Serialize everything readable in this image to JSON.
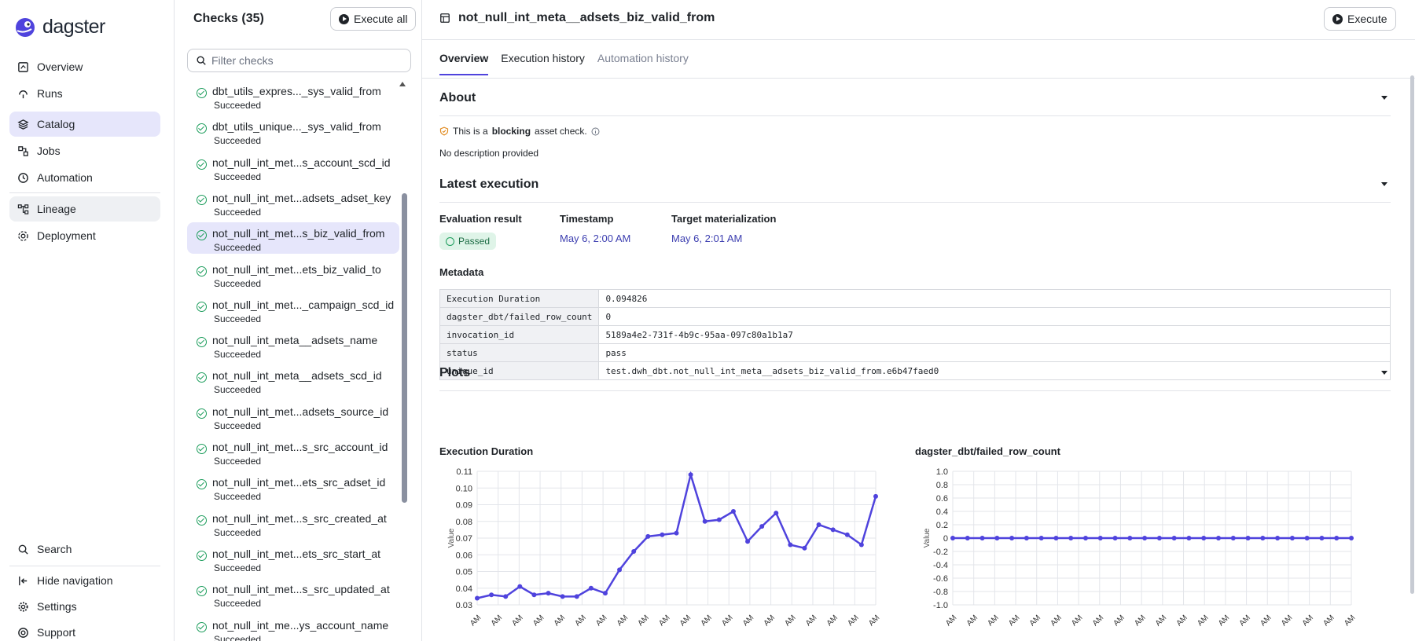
{
  "app": {
    "brand": "dagster",
    "accent": "#4f43dd"
  },
  "nav": {
    "items": [
      {
        "label": "Overview",
        "icon": "overview-icon"
      },
      {
        "label": "Runs",
        "icon": "runs-icon"
      },
      {
        "label": "Catalog",
        "icon": "catalog-icon"
      },
      {
        "label": "Jobs",
        "icon": "jobs-icon"
      },
      {
        "label": "Automation",
        "icon": "clock-icon"
      }
    ],
    "items2": [
      {
        "label": "Lineage",
        "icon": "lineage-icon"
      },
      {
        "label": "Deployment",
        "icon": "deployment-icon"
      }
    ],
    "bottom": [
      {
        "label": "Search",
        "icon": "search-icon"
      },
      {
        "label": "Hide navigation",
        "icon": "hide-nav-icon"
      },
      {
        "label": "Settings",
        "icon": "gear-icon"
      },
      {
        "label": "Support",
        "icon": "support-icon"
      }
    ]
  },
  "checks": {
    "title": "Checks (35)",
    "execute_all": "Execute all",
    "filter_placeholder": "Filter checks",
    "items": [
      {
        "name": "dbt_utils_expres..._sys_valid_from",
        "status": "Succeeded"
      },
      {
        "name": "dbt_utils_unique..._sys_valid_from",
        "status": "Succeeded"
      },
      {
        "name": "not_null_int_met...s_account_scd_id",
        "status": "Succeeded"
      },
      {
        "name": "not_null_int_met...adsets_adset_key",
        "status": "Succeeded"
      },
      {
        "name": "not_null_int_met...s_biz_valid_from",
        "status": "Succeeded"
      },
      {
        "name": "not_null_int_met...ets_biz_valid_to",
        "status": "Succeeded"
      },
      {
        "name": "not_null_int_met..._campaign_scd_id",
        "status": "Succeeded"
      },
      {
        "name": "not_null_int_meta__adsets_name",
        "status": "Succeeded"
      },
      {
        "name": "not_null_int_meta__adsets_scd_id",
        "status": "Succeeded"
      },
      {
        "name": "not_null_int_met...adsets_source_id",
        "status": "Succeeded"
      },
      {
        "name": "not_null_int_met...s_src_account_id",
        "status": "Succeeded"
      },
      {
        "name": "not_null_int_met...ets_src_adset_id",
        "status": "Succeeded"
      },
      {
        "name": "not_null_int_met...s_src_created_at",
        "status": "Succeeded"
      },
      {
        "name": "not_null_int_met...ets_src_start_at",
        "status": "Succeeded"
      },
      {
        "name": "not_null_int_met...s_src_updated_at",
        "status": "Succeeded"
      },
      {
        "name": "not_null_int_me...ys_account_name",
        "status": "Succeeded"
      }
    ]
  },
  "main": {
    "title": "not_null_int_meta__adsets_biz_valid_from",
    "execute": "Execute",
    "tabs": [
      "Overview",
      "Execution history",
      "Automation history"
    ],
    "about": {
      "title": "About",
      "blocking_pre": "This is a",
      "blocking_bold": "blocking",
      "blocking_post": "asset check.",
      "description": "No description provided"
    },
    "latest": {
      "title": "Latest execution",
      "eval_label": "Evaluation result",
      "eval_value": "Passed",
      "ts_label": "Timestamp",
      "ts_value": "May 6, 2:00 AM",
      "target_label": "Target materialization",
      "target_value": "May 6, 2:01 AM"
    },
    "metadata": {
      "title": "Metadata",
      "rows": [
        {
          "key": "Execution Duration",
          "value": "0.094826"
        },
        {
          "key": "dagster_dbt/failed_row_count",
          "value": "0"
        },
        {
          "key": "invocation_id",
          "value": "5189a4e2-731f-4b9c-95aa-097c80a1b1a7"
        },
        {
          "key": "status",
          "value": "pass"
        },
        {
          "key": "unique_id",
          "value": "test.dwh_dbt.not_null_int_meta__adsets_biz_valid_from.e6b47faed0"
        }
      ]
    },
    "plots_title": "Plots"
  },
  "chart_data": [
    {
      "type": "line",
      "title": "Execution Duration",
      "ylabel": "Value",
      "ylim": [
        0.03,
        0.11
      ],
      "yticks": [
        "0.11",
        "0.10",
        "0.09",
        "0.08",
        "0.07",
        "0.06",
        "0.05",
        "0.04",
        "0.03"
      ],
      "xtick_label": "AM",
      "color": "#4f43dd",
      "values": [
        0.034,
        0.036,
        0.035,
        0.041,
        0.036,
        0.037,
        0.035,
        0.035,
        0.04,
        0.037,
        0.051,
        0.062,
        0.071,
        0.072,
        0.073,
        0.108,
        0.08,
        0.081,
        0.086,
        0.068,
        0.077,
        0.085,
        0.066,
        0.064,
        0.078,
        0.075,
        0.072,
        0.066,
        0.095
      ]
    },
    {
      "type": "line",
      "title": "dagster_dbt/failed_row_count",
      "ylabel": "Value",
      "ylim": [
        -1.0,
        1.0
      ],
      "yticks": [
        "1.0",
        "0.8",
        "0.6",
        "0.4",
        "0.2",
        "0",
        "-0.2",
        "-0.4",
        "-0.6",
        "-0.8",
        "-1.0"
      ],
      "xtick_label": "AM",
      "color": "#4f43dd",
      "values": [
        0,
        0,
        0,
        0,
        0,
        0,
        0,
        0,
        0,
        0,
        0,
        0,
        0,
        0,
        0,
        0,
        0,
        0,
        0,
        0,
        0,
        0,
        0,
        0,
        0,
        0,
        0,
        0
      ]
    }
  ]
}
